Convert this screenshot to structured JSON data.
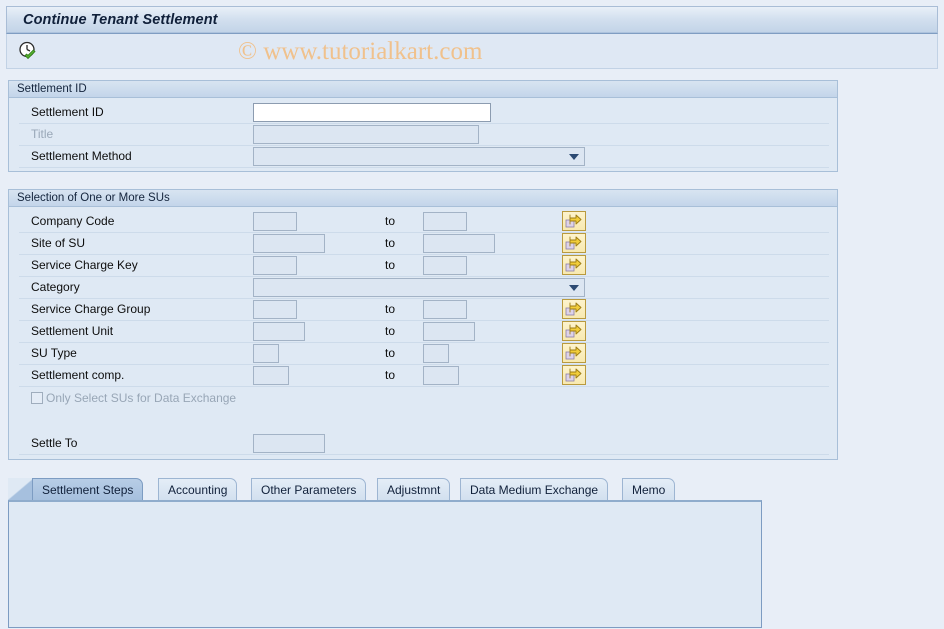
{
  "window": {
    "title": "Continue Tenant Settlement"
  },
  "toolbar": {
    "execute_icon": "clock-check-icon",
    "watermark": "© www.tutorialkart.com"
  },
  "groups": {
    "settlement_id": {
      "legend": "Settlement ID",
      "fields": [
        {
          "label": "Settlement ID",
          "type": "text",
          "value": "",
          "state": "editable"
        },
        {
          "label": "Title",
          "type": "text",
          "value": "",
          "state": "disabled"
        },
        {
          "label": "Settlement Method",
          "type": "dropdown",
          "value": "",
          "state": "disabled"
        }
      ]
    },
    "su_selection": {
      "legend": "Selection of One or More SUs",
      "to_label": "to",
      "range_rows": [
        {
          "label": "Company Code",
          "from": "",
          "to": "",
          "multiselect": true
        },
        {
          "label": "Site of SU",
          "from": "",
          "to": "",
          "multiselect": true
        },
        {
          "label": "Service Charge Key",
          "from": "",
          "to": "",
          "multiselect": true
        }
      ],
      "category": {
        "label": "Category",
        "type": "dropdown",
        "value": ""
      },
      "range_rows_2": [
        {
          "label": "Service Charge Group",
          "from": "",
          "to": "",
          "multiselect": true
        },
        {
          "label": "Settlement Unit",
          "from": "",
          "to": "",
          "multiselect": true
        },
        {
          "label": "SU Type",
          "from": "",
          "to": "",
          "multiselect": true
        },
        {
          "label": "Settlement comp.",
          "from": "",
          "to": "",
          "multiselect": true
        }
      ],
      "checkbox": {
        "label": "Only Select SUs for Data Exchange",
        "checked": false,
        "state": "disabled"
      },
      "settle_to": {
        "label": "Settle To",
        "value": ""
      }
    }
  },
  "tabs": [
    {
      "label": "Settlement Steps",
      "active": true
    },
    {
      "label": "Accounting",
      "active": false
    },
    {
      "label": "Other Parameters",
      "active": false
    },
    {
      "label": "Adjustmnt",
      "active": false
    },
    {
      "label": "Data Medium Exchange",
      "active": false
    },
    {
      "label": "Memo",
      "active": false
    }
  ],
  "colors": {
    "background": "#e8eef7",
    "group_bg": "#dfe9f4",
    "accent_border": "#a8bfd8",
    "watermark": "#f0c18c",
    "button_yellow": "#f8e9b0",
    "active_tab": "#a6c0de"
  }
}
